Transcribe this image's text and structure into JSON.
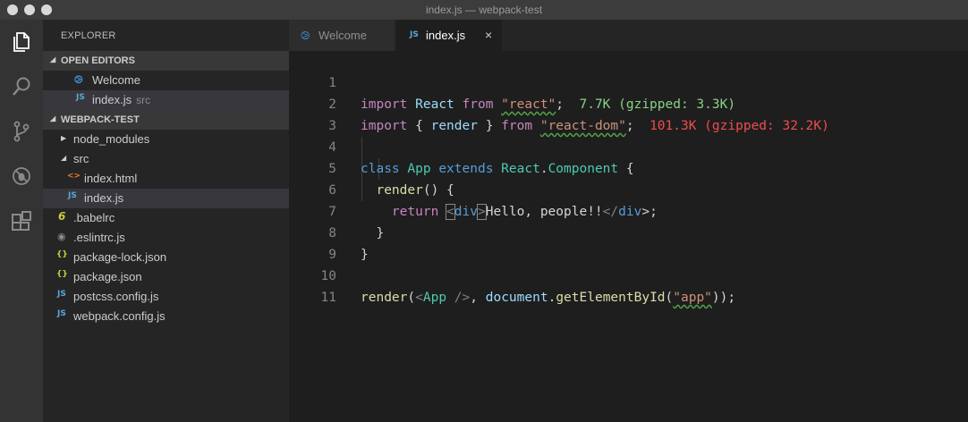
{
  "window": {
    "title": "index.js — webpack-test"
  },
  "activity": [
    "explorer-icon",
    "search-icon",
    "source-control-icon",
    "debug-icon",
    "extensions-icon"
  ],
  "sidebar": {
    "title": "EXPLORER",
    "open_editors": {
      "label": "OPEN EDITORS",
      "items": [
        {
          "name": "Welcome",
          "sub": ""
        },
        {
          "name": "index.js",
          "sub": "src"
        }
      ]
    },
    "project": {
      "label": "WEBPACK-TEST",
      "items": [
        {
          "name": "node_modules",
          "icon": ""
        },
        {
          "name": "src",
          "icon": ""
        },
        {
          "name": "index.html",
          "icon": "<>"
        },
        {
          "name": "index.js",
          "icon": "JS"
        },
        {
          "name": ".babelrc",
          "icon": "6"
        },
        {
          "name": ".eslintrc.js",
          "icon": "◉"
        },
        {
          "name": "package-lock.json",
          "icon": "{}"
        },
        {
          "name": "package.json",
          "icon": "{}"
        },
        {
          "name": "postcss.config.js",
          "icon": "JS"
        },
        {
          "name": "webpack.config.js",
          "icon": "JS"
        }
      ]
    }
  },
  "tabs": [
    {
      "label": "Welcome"
    },
    {
      "label": "index.js",
      "close": "×"
    }
  ],
  "editor": {
    "line_numbers": [
      "1",
      "2",
      "3",
      "4",
      "5",
      "6",
      "7",
      "8",
      "9",
      "10",
      "11"
    ],
    "line1": {
      "kw": "import",
      "id": "React",
      "from": "from",
      "str": "\"react\"",
      "semi": ";",
      "size": "7.7K (gzipped: 3.3K)"
    },
    "line2": {
      "kw": "import",
      "open": "{",
      "id": "render",
      "close": "}",
      "from": "from",
      "str": "\"react-dom\"",
      "semi": ";",
      "size": "101.3K (gzipped: 32.2K)"
    },
    "line4": {
      "kw": "class",
      "cls": "App",
      "ext": "extends",
      "obj": "React",
      "dot": ".",
      "comp": "Component",
      "brace": "{"
    },
    "line5": {
      "fn": "render",
      "rest": "() {"
    },
    "line6": {
      "kw": "return",
      "lt": "<",
      "tag": "div",
      "gt": ">",
      "text": "Hello, people!!",
      "closeTag": "</",
      "tag2": "div",
      "end": ">;"
    },
    "line7": {
      "brace": "}"
    },
    "line8": {
      "brace": "}"
    },
    "line10": {
      "fn": "render",
      "open": "(",
      "lt": "<",
      "cls": "App",
      "selfclose": " />",
      "comma": ", ",
      "doc": "document",
      "dot": ".",
      "method": "getElementById",
      "popen": "(",
      "str": "\"app\"",
      "end": "));"
    }
  }
}
